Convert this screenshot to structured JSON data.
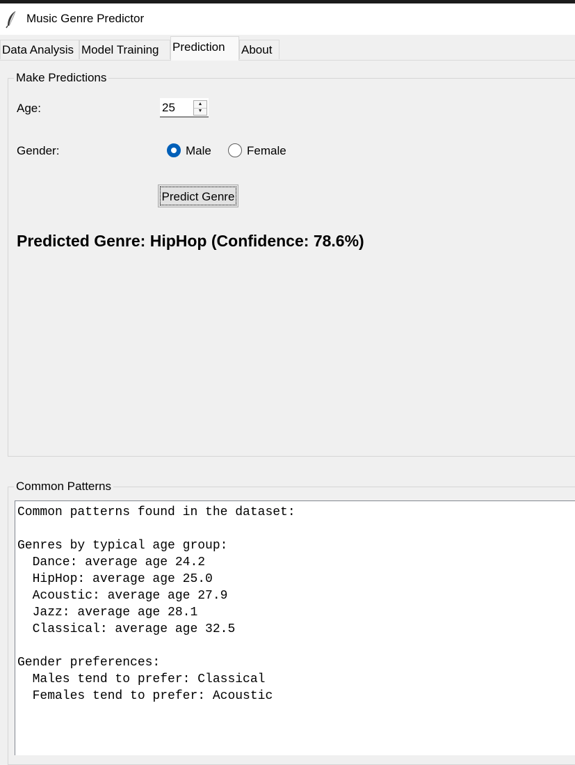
{
  "window": {
    "title": "Music Genre Predictor",
    "icon": "feather-icon"
  },
  "tabs": [
    {
      "label": "Data Analysis",
      "active": false
    },
    {
      "label": "Model Training",
      "active": false
    },
    {
      "label": "Prediction",
      "active": true
    },
    {
      "label": "About",
      "active": false
    }
  ],
  "predictions": {
    "group_title": "Make Predictions",
    "age_label": "Age:",
    "age_value": "25",
    "gender_label": "Gender:",
    "gender_options": [
      "Male",
      "Female"
    ],
    "gender_selected": "Male",
    "predict_button": "Predict Genre",
    "result": "Predicted Genre: HipHop (Confidence: 78.6%)"
  },
  "patterns": {
    "group_title": "Common Patterns",
    "lines": [
      "Common patterns found in the dataset:",
      "",
      "Genres by typical age group:",
      "  Dance: average age 24.2",
      "  HipHop: average age 25.0",
      "  Acoustic: average age 27.9",
      "  Jazz: average age 28.1",
      "  Classical: average age 32.5",
      "",
      "Gender preferences:",
      "  Males tend to prefer: Classical",
      "  Females tend to prefer: Acoustic"
    ]
  },
  "colors": {
    "accent": "#005fb8",
    "window_bg": "#f0f0f0",
    "text_bg": "#ffffff"
  }
}
